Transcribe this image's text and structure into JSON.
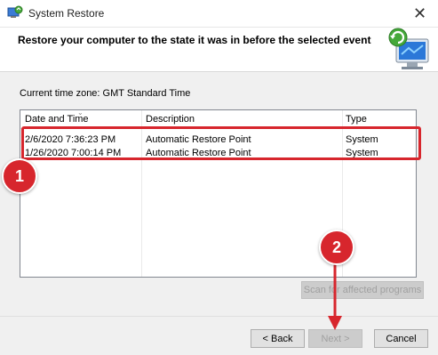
{
  "window": {
    "title": "System Restore",
    "close_glyph": "✕"
  },
  "heading": "Restore your computer to the state it was in before the selected event",
  "timezone": "Current time zone: GMT Standard Time",
  "table": {
    "columns": [
      "Date and Time",
      "Description",
      "Type"
    ],
    "rows": [
      {
        "date": "2/6/2020 7:36:23 PM",
        "description": "Automatic Restore Point",
        "type": "System"
      },
      {
        "date": "1/26/2020 7:00:14 PM",
        "description": "Automatic Restore Point",
        "type": "System"
      }
    ]
  },
  "buttons": {
    "scan": "Scan for affected programs",
    "back": "< Back",
    "next": "Next >",
    "cancel": "Cancel"
  },
  "annotations": {
    "badge1": "1",
    "badge2": "2",
    "accent": "#d7262d"
  },
  "icons": {
    "app": "system-restore-icon",
    "hero": "computer-restore-icon",
    "sort": "sort-arrow-icon"
  }
}
